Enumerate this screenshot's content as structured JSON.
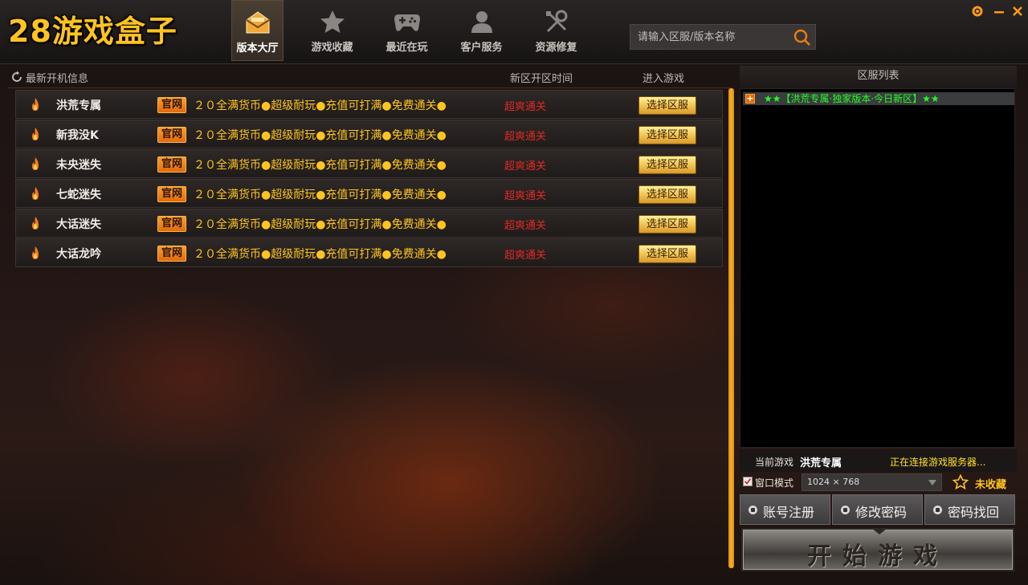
{
  "app": {
    "logo": "28游戏盒子"
  },
  "nav": {
    "items": [
      {
        "label": "版本大厅",
        "icon": "mail-icon",
        "active": true
      },
      {
        "label": "游戏收藏",
        "icon": "star-icon",
        "active": false
      },
      {
        "label": "最近在玩",
        "icon": "gamepad-icon",
        "active": false
      },
      {
        "label": "客户服务",
        "icon": "user-icon",
        "active": false
      },
      {
        "label": "资源修复",
        "icon": "tools-icon",
        "active": false
      }
    ]
  },
  "search": {
    "placeholder": "请输入区服/版本名称"
  },
  "left": {
    "title": "最新开机信息",
    "col_time": "新区开区时间",
    "col_enter": "进入游戏",
    "rows": [
      {
        "name": "洪荒专属",
        "badge": "官网",
        "desc": "２０全满货币●超级耐玩●充值可打满●免费通关●",
        "time": "超爽通关",
        "button": "选择区服"
      },
      {
        "name": "新我没K",
        "badge": "官网",
        "desc": "２０全满货币●超级耐玩●充值可打满●免费通关●",
        "time": "超爽通关",
        "button": "选择区服"
      },
      {
        "name": "未央迷失",
        "badge": "官网",
        "desc": "２０全满货币●超级耐玩●充值可打满●免费通关●",
        "time": "超爽通关",
        "button": "选择区服"
      },
      {
        "name": "七蛇迷失",
        "badge": "官网",
        "desc": "２０全满货币●超级耐玩●充值可打满●免费通关●",
        "time": "超爽通关",
        "button": "选择区服"
      },
      {
        "name": "大话迷失",
        "badge": "官网",
        "desc": "２０全满货币●超级耐玩●充值可打满●免费通关●",
        "time": "超爽通关",
        "button": "选择区服"
      },
      {
        "name": "大话龙吟",
        "badge": "官网",
        "desc": "２０全满货币●超级耐玩●充值可打满●免费通关●",
        "time": "超爽通关",
        "button": "选择区服"
      }
    ]
  },
  "right": {
    "title": "区服列表",
    "servers": [
      {
        "plus": "+",
        "label": "★★【洪荒专属·独家版本·今日新区】★★"
      }
    ],
    "current_label": "当前游戏",
    "current_game": "洪荒专属",
    "status": "正在连接游戏服务器...",
    "window_mode": "窗口模式",
    "resolution": "1024 × 768",
    "favorite": "未收藏",
    "buttons": {
      "register": "账号注册",
      "change_pwd": "修改密码",
      "recover_pwd": "密码找回"
    },
    "start": "开始游戏"
  },
  "colors": {
    "accent_gold": "#ffc322",
    "time_red": "#e02a25",
    "server_green": "#22ff22",
    "badge_orange": "#e06a0d"
  }
}
